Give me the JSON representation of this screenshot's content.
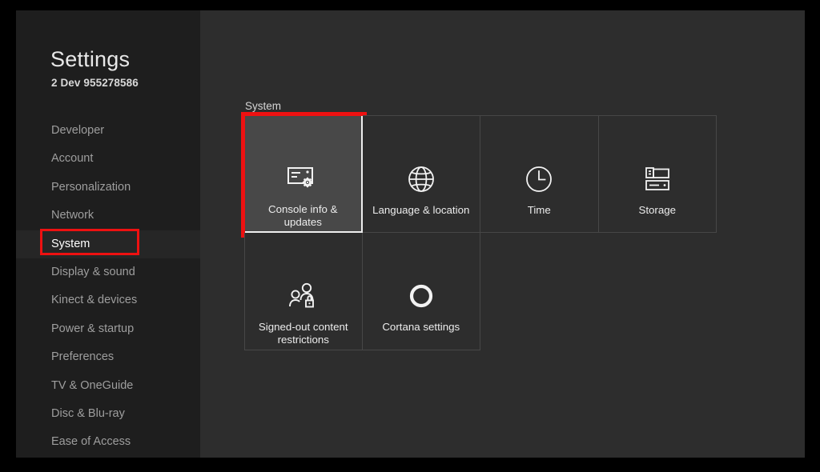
{
  "window": {
    "app_title": "Settings",
    "app_subtitle": "2 Dev 955278586"
  },
  "sidebar": {
    "items": [
      {
        "label": "Developer",
        "active": false
      },
      {
        "label": "Account",
        "active": false
      },
      {
        "label": "Personalization",
        "active": false
      },
      {
        "label": "Network",
        "active": false
      },
      {
        "label": "System",
        "active": true
      },
      {
        "label": "Display & sound",
        "active": false
      },
      {
        "label": "Kinect & devices",
        "active": false
      },
      {
        "label": "Power & startup",
        "active": false
      },
      {
        "label": "Preferences",
        "active": false
      },
      {
        "label": "TV & OneGuide",
        "active": false
      },
      {
        "label": "Disc & Blu-ray",
        "active": false
      },
      {
        "label": "Ease of Access",
        "active": false
      }
    ]
  },
  "content": {
    "group_label": "System",
    "tiles": [
      {
        "label": "Console info & updates",
        "icon": "console-gear-icon",
        "selected": true
      },
      {
        "label": "Language & location",
        "icon": "globe-icon",
        "selected": false
      },
      {
        "label": "Time",
        "icon": "clock-icon",
        "selected": false
      },
      {
        "label": "Storage",
        "icon": "storage-icon",
        "selected": false
      },
      {
        "label": "Signed-out content restrictions",
        "icon": "people-lock-icon",
        "selected": false
      },
      {
        "label": "Cortana settings",
        "icon": "cortana-ring-icon",
        "selected": false
      }
    ]
  },
  "annotations": {
    "highlight_color": "#ee1111",
    "sidebar_target": "System",
    "tile_target": "Console info & updates"
  }
}
